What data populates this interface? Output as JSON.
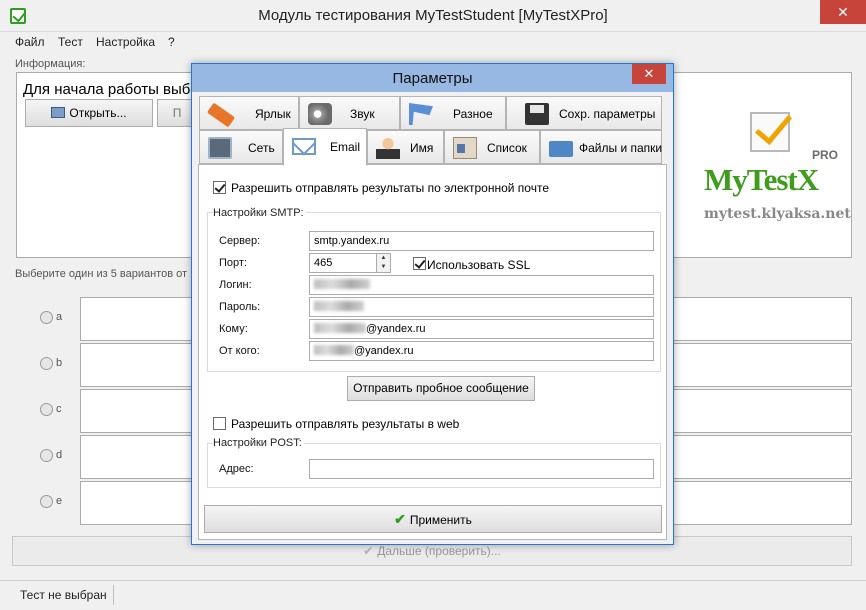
{
  "window": {
    "title": "Модуль тестирования MyTestStudent [MyTestXPro]",
    "close": "✕",
    "icon": "checkbox-app-icon"
  },
  "menu": [
    "Файл",
    "Тест",
    "Настройка",
    "?"
  ],
  "info": {
    "label": "Информация:",
    "text": "Для начала работы выбе",
    "open_button": "Открыть...",
    "second_button": "П"
  },
  "logo": {
    "pro": "PRO",
    "name": "MyTestX",
    "url": "mytest.klyaksa.net"
  },
  "answers": {
    "label": "Выберите один из 5 вариантов от",
    "options": [
      "a",
      "b",
      "c",
      "d",
      "e"
    ]
  },
  "next_button": "Дальше (проверить)...",
  "status": {
    "text": "Тест не выбран"
  },
  "dialog": {
    "title": "Параметры",
    "close": "✕",
    "tabs_row1": [
      {
        "label": "Ярлык",
        "icon": "label-icon"
      },
      {
        "label": "Звук",
        "icon": "speaker-icon"
      },
      {
        "label": "Разное",
        "icon": "flag-icon"
      },
      {
        "label": "Сохр. параметры",
        "icon": "floppy-disk-icon"
      }
    ],
    "tabs_row2": [
      {
        "label": "Сеть",
        "icon": "network-icon"
      },
      {
        "label": "Email",
        "icon": "envelope-icon"
      },
      {
        "label": "Имя",
        "icon": "person-icon"
      },
      {
        "label": "Список",
        "icon": "id-card-icon"
      },
      {
        "label": "Файлы и папки",
        "icon": "folder-icon"
      }
    ],
    "active_tab": "Email",
    "email": {
      "allow_email_label": "Разрешить отправлять результаты по электронной почте",
      "allow_email_checked": true,
      "smtp_title": "Настройки SMTP:",
      "server_label": "Сервер:",
      "server_value": "smtp.yandex.ru",
      "port_label": "Порт:",
      "port_value": "465",
      "ssl_label": "Использовать SSL",
      "ssl_checked": true,
      "login_label": "Логин:",
      "password_label": "Пароль:",
      "to_label": "Кому:",
      "to_domain": "@yandex.ru",
      "from_label": "От кого:",
      "from_domain": "@yandex.ru",
      "send_test_button": "Отправить пробное сообщение",
      "allow_web_label": "Разрешить отправлять результаты в web",
      "allow_web_checked": false,
      "post_title": "Настройки POST:",
      "address_label": "Адрес:",
      "address_value": ""
    },
    "apply_button": "Применить"
  }
}
